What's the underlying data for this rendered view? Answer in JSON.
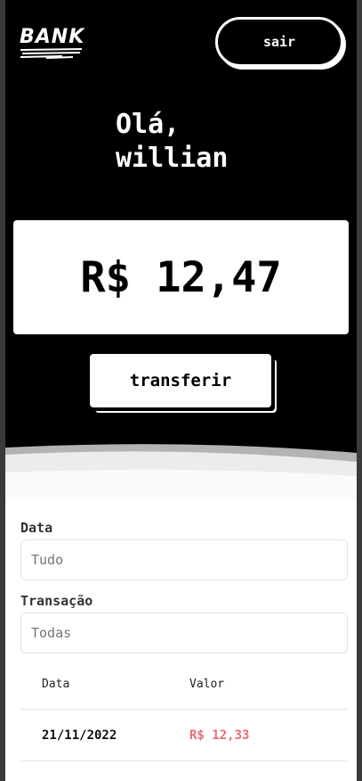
{
  "header": {
    "logo_text": "BANK",
    "logout_label": "sair"
  },
  "greeting": {
    "line1": "Olá,",
    "line2": "willian"
  },
  "balance": {
    "value": "R$ 12,47"
  },
  "actions": {
    "transfer_label": "transferir"
  },
  "filters": {
    "date_label": "Data",
    "date_placeholder": "Tudo",
    "transaction_label": "Transação",
    "transaction_placeholder": "Todas"
  },
  "table": {
    "headers": [
      "Data",
      "Valor"
    ],
    "rows": [
      {
        "date": "21/11/2022",
        "value": "R$ 12,33"
      }
    ]
  },
  "colors": {
    "hero_background": "#000000",
    "negative_value": "#ee6b73"
  }
}
